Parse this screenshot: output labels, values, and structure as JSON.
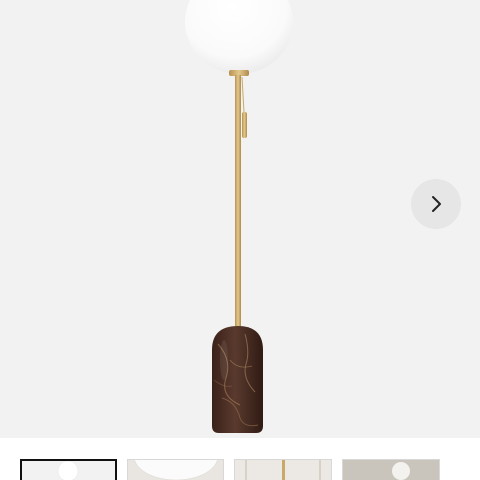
{
  "gallery": {
    "next_button_icon": "chevron-right-icon",
    "thumbnails": [
      {
        "name": "thumbnail-1",
        "selected": true
      },
      {
        "name": "thumbnail-2",
        "selected": false
      },
      {
        "name": "thumbnail-3",
        "selected": false
      },
      {
        "name": "thumbnail-4",
        "selected": false
      }
    ]
  },
  "colors": {
    "background": "#f2f2f2",
    "brass": "#c9a86a",
    "marble": "#4a2e24",
    "globe": "#ffffff",
    "selected_border": "#111111"
  }
}
